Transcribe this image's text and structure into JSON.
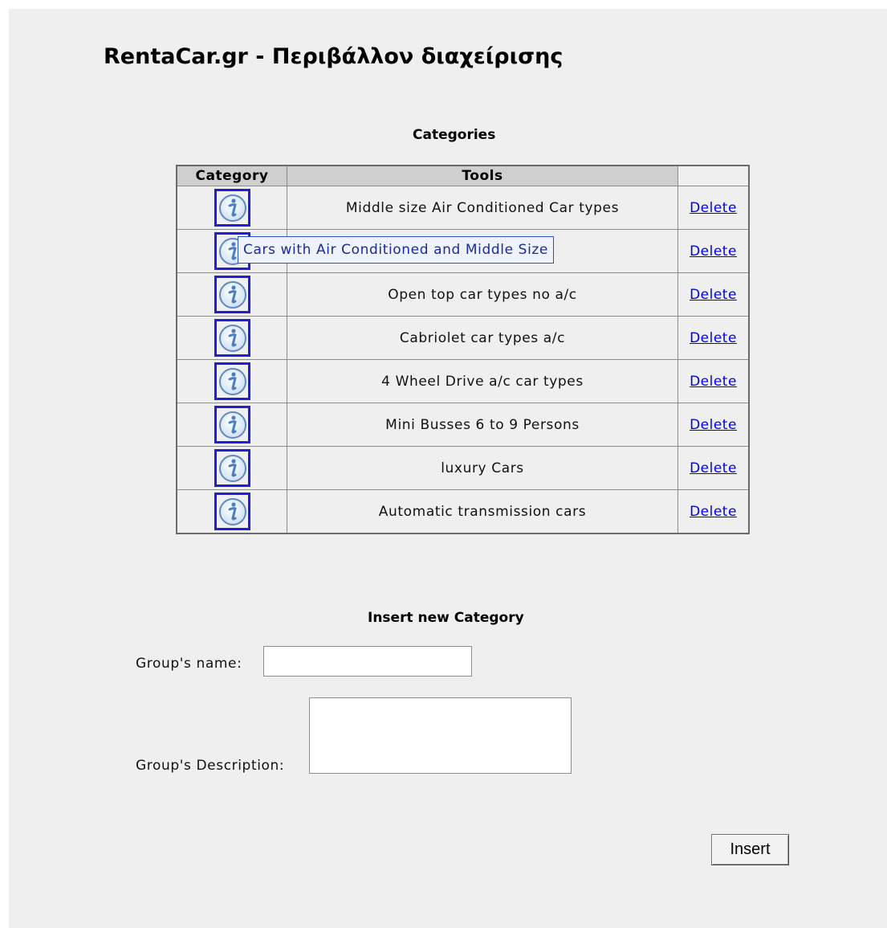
{
  "page": {
    "title": "RentaCar.gr - Περιβάλλον διαχείρισης"
  },
  "categories": {
    "section_title": "Categories",
    "headers": {
      "category": "Category",
      "tools": "Tools"
    },
    "rows": [
      {
        "description": "Middle size Air Conditioned Car types",
        "delete_label": "Delete"
      },
      {
        "description": "",
        "delete_label": "Delete"
      },
      {
        "description": "Open top car types no a/c",
        "delete_label": "Delete"
      },
      {
        "description": "Cabriolet car types a/c",
        "delete_label": "Delete"
      },
      {
        "description": "4 Wheel Drive a/c car types",
        "delete_label": "Delete"
      },
      {
        "description": "Mini Busses 6 to 9 Persons",
        "delete_label": "Delete"
      },
      {
        "description": "luxury Cars",
        "delete_label": "Delete"
      },
      {
        "description": "Automatic transmission cars",
        "delete_label": "Delete"
      }
    ],
    "info_icon": "info-icon",
    "tooltip": "Cars with Air Conditioned and Middle Size"
  },
  "insert_form": {
    "section_title": "Insert new Category",
    "name_label": "Group's name:",
    "name_value": "",
    "description_label": "Group's Description:",
    "description_value": "",
    "submit_label": "Insert"
  },
  "colors": {
    "background": "#efefef",
    "header_bg": "#cfcfcf",
    "link": "#0000ee",
    "icon_border": "#1f1fd6"
  }
}
